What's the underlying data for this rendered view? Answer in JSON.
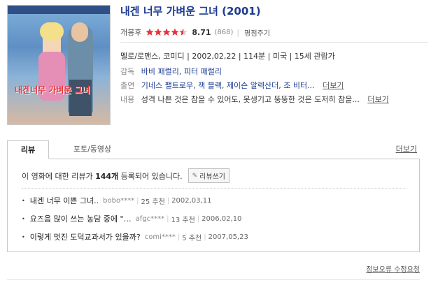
{
  "movie": {
    "title": "내겐 너무 가벼운 그녀 (2001)",
    "rating_prefix": "개봉후",
    "stars": 4.5,
    "score": "8.71",
    "vote_count": "(868)",
    "rate_button": "평점주기",
    "meta": "멜로/로맨스, 코미디 | 2002,02,22 | 114분 | 미국 | 15세 관람가",
    "director_label": "감독",
    "directors": "바비 패럴리, 피터 패럴리",
    "cast_label": "출연",
    "cast": "기네스 팰트로우, 잭 블랙, 제이슨 알렉산더, 조 비터...",
    "cast_more": "더보기",
    "plot_label": "내용",
    "plot": "성격 나쁜 것은 참을 수 있어도, 못생기고 뚱뚱한 것은 도저히 참을...",
    "plot_more": "더보기"
  },
  "poster": {
    "title_text": "내겐너무 가벼운 그녀"
  },
  "tabs": {
    "items": [
      {
        "label": "리뷰"
      },
      {
        "label": "포토/동영상"
      }
    ],
    "more": "더보기"
  },
  "reviews": {
    "count_prefix": "이 영화에 대한 리뷰가",
    "count": "144개",
    "count_suffix": "등록되어 있습니다.",
    "write_button": "리뷰쓰기",
    "items": [
      {
        "title": "내겐 너무 이쁜 그녀..",
        "author": "bobo****",
        "votes": "25 추천",
        "date": "2002,03,11"
      },
      {
        "title": "요즈음 많이 쓰는 농담 중에 \"…",
        "author": "afgc****",
        "votes": "13 추천",
        "date": "2006,02,10"
      },
      {
        "title": "이렇게 멋진 도덕교과서가 있을까?",
        "author": "comi****",
        "votes": "5 추천",
        "date": "2007,05,23"
      }
    ]
  },
  "footer": {
    "report": "정보오류 수정요청"
  },
  "colors": {
    "link_blue": "#1b3a91",
    "star_red": "#e8353a"
  }
}
